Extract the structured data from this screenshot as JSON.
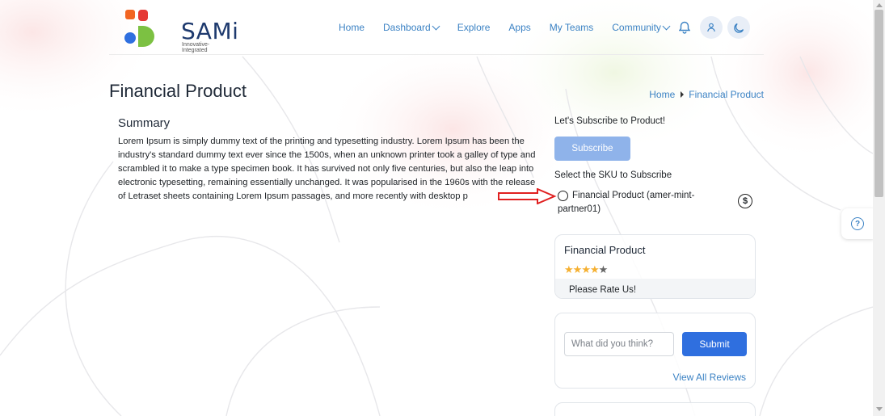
{
  "brand": {
    "name": "SAMi",
    "tagline": "Innovative-Integrated",
    "colors": {
      "orange": "#f26522",
      "red": "#e53935",
      "blue": "#2f6fdf",
      "green": "#7cc142"
    }
  },
  "nav": {
    "items": [
      {
        "label": "Home"
      },
      {
        "label": "Dashboard",
        "dropdown": true
      },
      {
        "label": "Explore"
      },
      {
        "label": "Apps"
      },
      {
        "label": "My Teams"
      },
      {
        "label": "Community",
        "dropdown": true
      }
    ],
    "icons": [
      "bell-icon",
      "user-icon",
      "moon-icon"
    ]
  },
  "page": {
    "title": "Financial Product",
    "breadcrumb": {
      "home": "Home",
      "current": "Financial Product"
    }
  },
  "summary": {
    "heading": "Summary",
    "text": "Lorem Ipsum is simply dummy text of the printing and typesetting industry. Lorem Ipsum has been the industry's standard dummy text ever since the 1500s, when an unknown printer took a galley of type and scrambled it to make a type specimen book. It has survived not only five centuries, but also the leap into electronic typesetting, remaining essentially unchanged. It was popularised in the 1960s with the release of Letraset sheets containing Lorem Ipsum passages, and more recently with desktop p"
  },
  "subscribe": {
    "label": "Let's Subscribe to Product!",
    "button": "Subscribe",
    "sku_label": "Select the SKU to Subscribe",
    "sku_option": "Financial Product (amer-mint-partner01)",
    "sku_icon": "dollar-icon"
  },
  "rating": {
    "title": "Financial Product",
    "stars_filled": 4,
    "stars_total": 5,
    "prompt": "Please Rate Us!"
  },
  "review": {
    "placeholder": "What did you think?",
    "submit": "Submit",
    "view_all": "View All Reviews"
  },
  "help": {
    "icon": "question-icon",
    "glyph": "?"
  },
  "theme": {
    "link": "#3b82c4",
    "primary": "#2f6fdf",
    "subscribe_btn": "#8fb3ea"
  }
}
